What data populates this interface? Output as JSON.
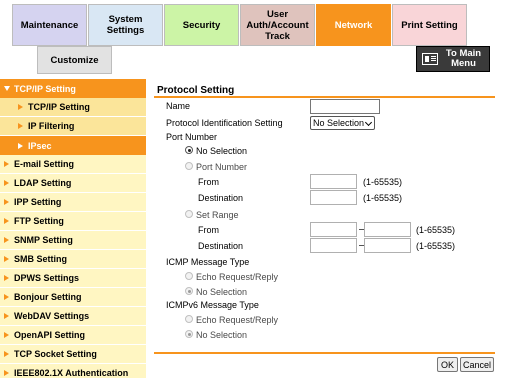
{
  "tabs": {
    "maintenance": "Maintenance",
    "system_settings": "System Settings",
    "security": "Security",
    "user_auth": "User Auth/Account Track",
    "network": "Network",
    "print_setting": "Print Setting",
    "customize": "Customize"
  },
  "main_menu_button": "To Main\nMenu",
  "sidebar": {
    "items": [
      {
        "label": "TCP/IP Setting",
        "state": "expanded"
      },
      {
        "label": "TCP/IP Setting",
        "state": "child"
      },
      {
        "label": "IP Filtering",
        "state": "child"
      },
      {
        "label": "IPsec",
        "state": "selected"
      },
      {
        "label": "E-mail Setting",
        "state": "collapsed"
      },
      {
        "label": "LDAP Setting",
        "state": "collapsed"
      },
      {
        "label": "IPP Setting",
        "state": "collapsed"
      },
      {
        "label": "FTP Setting",
        "state": "collapsed"
      },
      {
        "label": "SNMP Setting",
        "state": "collapsed"
      },
      {
        "label": "SMB Setting",
        "state": "collapsed"
      },
      {
        "label": "DPWS Settings",
        "state": "collapsed"
      },
      {
        "label": "Bonjour Setting",
        "state": "collapsed"
      },
      {
        "label": "WebDAV Settings",
        "state": "collapsed"
      },
      {
        "label": "OpenAPI Setting",
        "state": "collapsed"
      },
      {
        "label": "TCP Socket Setting",
        "state": "collapsed"
      },
      {
        "label": "IEEE802.1X Authentication",
        "state": "collapsed"
      }
    ]
  },
  "form": {
    "title": "Protocol Setting",
    "name_label": "Name",
    "name_value": "",
    "proto_id_label": "Protocol Identification Setting",
    "proto_id_value": "No Selection",
    "port_number_label": "Port Number",
    "port_no_selection": "No Selection",
    "port_number_option": "Port Number",
    "from_label": "From",
    "destination_label": "Destination",
    "set_range_option": "Set Range",
    "range_hint": "(1-65535)",
    "icmp_label": "ICMP Message Type",
    "icmp_echo": "Echo Request/Reply",
    "icmp_none": "No Selection",
    "icmpv6_label": "ICMPv6 Message Type",
    "icmpv6_echo": "Echo Request/Reply",
    "icmpv6_none": "No Selection",
    "ok": "OK",
    "cancel": "Cancel"
  },
  "colors": {
    "accent": "#f7941d",
    "sidebar_bg": "#fff6c2",
    "sidebar_child_bg": "#fbe59a"
  }
}
